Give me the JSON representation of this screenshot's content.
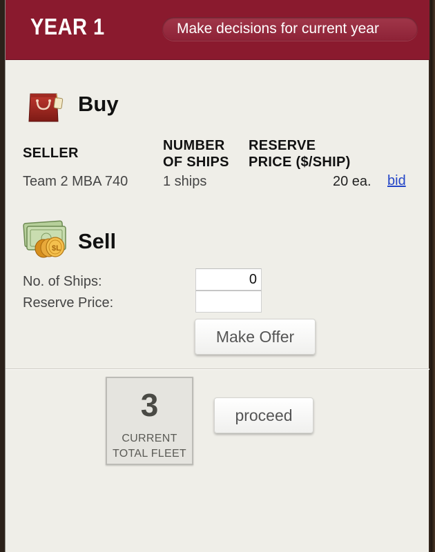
{
  "header": {
    "year_title": "YEAR 1",
    "instruction": "Make decisions for current year"
  },
  "buy": {
    "title": "Buy",
    "icon": "shopping-bag-icon",
    "columns": {
      "seller": "SELLER",
      "number_of_ships_line1": "NUMBER",
      "number_of_ships_line2": "OF SHIPS",
      "reserve_price_line1": "RESERVE",
      "reserve_price_line2": "PRICE ($/SHIP)"
    },
    "rows": [
      {
        "seller": "Team 2 MBA 740",
        "ships": "1 ships",
        "price": "20 ea.",
        "action": "bid"
      }
    ]
  },
  "sell": {
    "title": "Sell",
    "icon": "cash-coins-icon",
    "ships_label": "No. of Ships:",
    "ships_value": "0",
    "reserve_label": "Reserve Price:",
    "reserve_value": "",
    "offer_button": "Make Offer"
  },
  "fleet": {
    "value": "3",
    "label_line1": "CURRENT",
    "label_line2": "TOTAL FLEET"
  },
  "proceed_button": "proceed",
  "colors": {
    "header": "#8a1a2e",
    "panel": "#efeee8",
    "link": "#2345c8"
  }
}
